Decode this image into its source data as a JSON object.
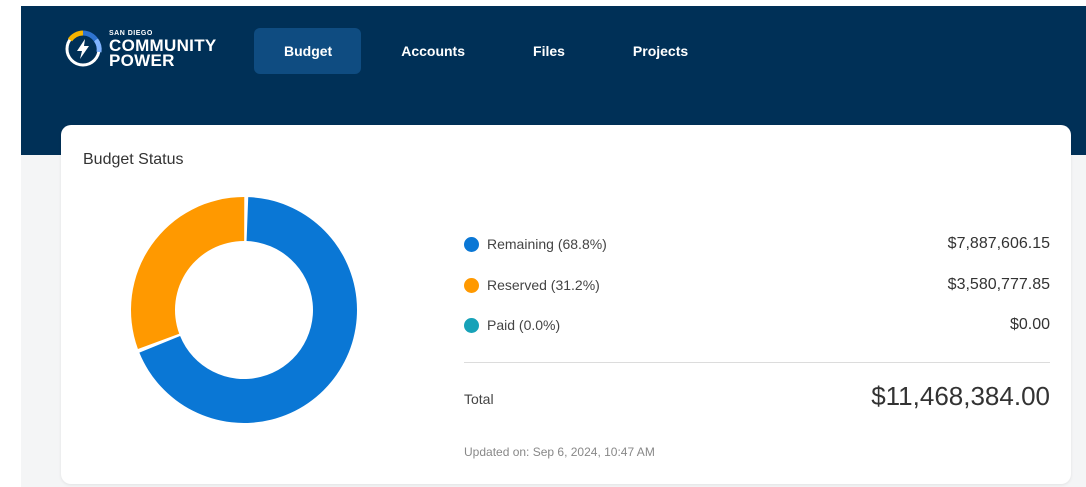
{
  "brand": {
    "line1": "SAN DIEGO",
    "line2": "COMMUNITY",
    "line3": "POWER",
    "colors": {
      "header": "#003057",
      "yellow": "#f5b400",
      "blue": "#2f74d0",
      "lightblue": "#7fb3ff"
    }
  },
  "nav": {
    "items": [
      {
        "label": "Budget",
        "active": true
      },
      {
        "label": "Accounts",
        "active": false
      },
      {
        "label": "Files",
        "active": false
      },
      {
        "label": "Projects",
        "active": false
      }
    ]
  },
  "budget_status": {
    "title": "Budget Status",
    "legend": [
      {
        "label": "Remaining (68.8%)",
        "value": "$7,887,606.15",
        "color": "#0a77d5"
      },
      {
        "label": "Reserved (31.2%)",
        "value": "$3,580,777.85",
        "color": "#ff9900"
      },
      {
        "label": "Paid (0.0%)",
        "value": "$0.00",
        "color": "#17a2b8"
      }
    ],
    "total_label": "Total",
    "total_value": "$11,468,384.00",
    "updated": "Updated on: Sep 6, 2024, 10:47 AM"
  },
  "chart_data": {
    "type": "pie",
    "categories": [
      "Remaining",
      "Reserved",
      "Paid"
    ],
    "values": [
      68.8,
      31.2,
      0.0
    ],
    "colors": [
      "#0a77d5",
      "#ff9900",
      "#17a2b8"
    ]
  }
}
